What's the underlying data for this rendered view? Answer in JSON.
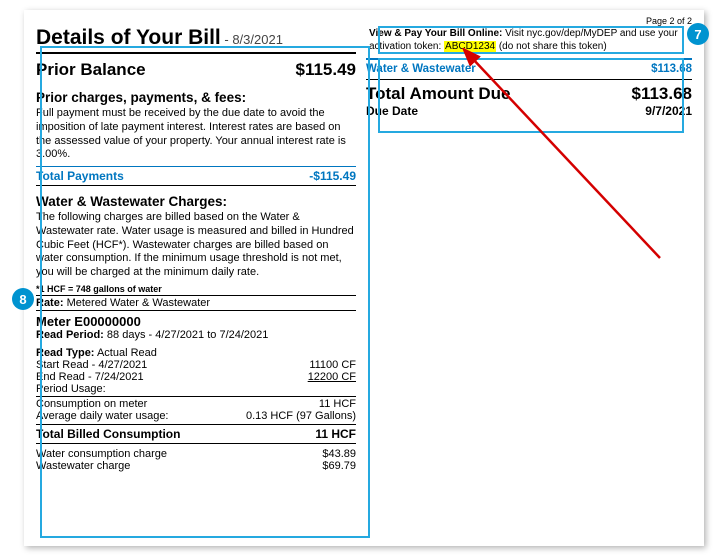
{
  "page_number": "Page 2 of 2",
  "title": "Details of Your Bill",
  "title_date": " - 8/3/2021",
  "prior_balance": {
    "label": "Prior Balance",
    "amount": "$115.49"
  },
  "prior_section": {
    "heading": "Prior charges, payments, & fees:",
    "text": "Full payment must be received by the due date to avoid the imposition of late payment interest. Interest rates are based on the assessed value of your property. Your annual interest rate is 3.00%."
  },
  "total_payments": {
    "label": "Total Payments",
    "amount": "-$115.49"
  },
  "ww_section": {
    "heading": "Water & Wastewater Charges:",
    "text": "The following charges are billed based on the Water & Wastewater rate.  Water usage is measured and billed in Hundred Cubic Feet (HCF*).  Wastewater charges are billed based on water consumption.  If the minimum usage threshold is not met, you will be charged at the minimum daily rate."
  },
  "hcf_note": "*1 HCF = 748 gallons of water",
  "rate": {
    "label": "Rate:",
    "value": "Metered Water & Wastewater"
  },
  "meter": {
    "name": "Meter E00000000",
    "read_period_label": "Read Period:",
    "read_period": "88 days - 4/27/2021 to 7/24/2021",
    "read_type_label": "Read Type:",
    "read_type": "Actual Read",
    "start_read": {
      "label": "Start Read - 4/27/2021",
      "value": "11100 CF"
    },
    "end_read": {
      "label": "End Read - 7/24/2021",
      "value": "12200 CF"
    },
    "period_usage": {
      "label": "Period Usage:",
      "value": ""
    },
    "consumption_on_meter": {
      "label": "Consumption on meter",
      "value": "11 HCF"
    },
    "avg_daily": {
      "label": "Average daily water usage:",
      "value": "0.13 HCF (97 Gallons)"
    }
  },
  "total_billed": {
    "label": "Total Billed Consumption",
    "value": "11 HCF"
  },
  "charges": {
    "water": {
      "label": "Water consumption charge",
      "value": "$43.89"
    },
    "wastewater": {
      "label": "Wastewater charge",
      "value": "$69.79"
    }
  },
  "online": {
    "bold": "View & Pay Your Bill Online:",
    "text1": " Visit nyc.gov/dep/MyDEP and use your activation token: ",
    "token": "ABCD1234",
    "text2": " (do not share this token)"
  },
  "ww_line": {
    "label": "Water & Wastewater",
    "amount": "$113.68"
  },
  "total_due": {
    "label": "Total Amount Due",
    "amount": "$113.68"
  },
  "due_date": {
    "label": "Due Date",
    "value": "9/7/2021"
  },
  "badges": {
    "seven": "7",
    "eight": "8"
  }
}
